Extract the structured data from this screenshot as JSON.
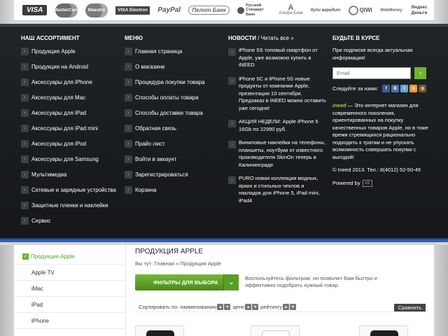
{
  "payments": [
    "VISA",
    "MasterCard",
    "Maestro",
    "VISA Electron",
    "PayPal",
    "Пелот Банк",
    "Русский Стандарт Банк",
    "Альфа-Банк",
    "Купи вкредит",
    "QIWI",
    "WebMoney",
    "Яндекс Деньги"
  ],
  "footer": {
    "col1": {
      "heading": "НАШ АССОРТИМЕНТ",
      "items": [
        "Продукция Apple",
        "Продукция на Android",
        "Аксессуары для iPhone",
        "Аксессуары для Mac",
        "Аксессуары для iPad",
        "Аксессуары для iPad mini",
        "Аксессуары для iPod",
        "Аксессуары для Samsung",
        "Мультимедиа",
        "Сетевые и зарядные устройства",
        "Защитные пленки и наклейки",
        "Сервис"
      ]
    },
    "col2": {
      "heading": "МЕНЮ",
      "items": [
        "Главная страница",
        "О магазине",
        "Процедура покупки товара",
        "Способы оплаты товара",
        "Способы доставки товара",
        "Обратная связь",
        "Прайс-лист",
        "Войти в аккаунт",
        "Зарегистрироваться",
        "Корзина"
      ]
    },
    "col3": {
      "heading": "НОВОСТИ",
      "heading_sep": " / ",
      "heading_sub": "Читать все »",
      "items": [
        "iPhone 5S топовый смартфон от Apple, уже возможно купить в iNEED",
        "iPhone 5C и iPhone 5S новые продукты от компании Apple, презентация 10 сентября. Предзаказ в iNEED можно оставить уже сегодня!",
        "АКЦИЯ НЕДЕЛИ: Apple iPhone 5 16Gb по 22990 руб.",
        "Виниловые наклейки на телефоны, планшеты, ноутбуки от известного производителя SkinOn теперь в Калининграде",
        "PURO новая коллекция модных, ярких и стильных чехлов и накладок для iPhone 5, iPad mini, iPad4"
      ]
    },
    "col4": {
      "heading": "БУДЬТЕ В КУРСЕ",
      "subscribe_text": "При подписке всегда актуальная информация!",
      "email_placeholder": "Email",
      "social_label": "Следуйте за нами:",
      "about_brand": "ineed",
      "about_text": " — Это интернет магазин для современного поколения, ориентированных на покупку качественных товаров Apple, но в тоже время стремящихся рационально подходить к тратам и не упускать возможность совершать покупки с выгодой!",
      "copyright": "© Ineed 2013. Тел.: 8(4012) 52-50-49",
      "powered": "Powered by",
      "powered_logo": "V2"
    }
  },
  "sidebar": {
    "items": [
      "Продукция Apple",
      "Apple TV",
      "iMac",
      "iPad",
      "iPhone"
    ]
  },
  "main": {
    "title": "ПРОДУКЦИЯ APPLE",
    "breadcrumb_prefix": "Вы тут:",
    "breadcrumb_home": "Главная",
    "breadcrumb_sep": "»",
    "breadcrumb_current": "Продукция Apple",
    "filter_button": "ФИЛЬТРЫ ДЛЯ ВЫБОРА",
    "filter_hint": "Воспользуйтесь фильтром, он позволит Вам быстро и эффективно подобрать нужный товар.",
    "sort_label": "Сортировать по: наименованию",
    "sort_price": "цене",
    "sort_rating": "рейтингу",
    "compare_button": "Сравнить"
  }
}
